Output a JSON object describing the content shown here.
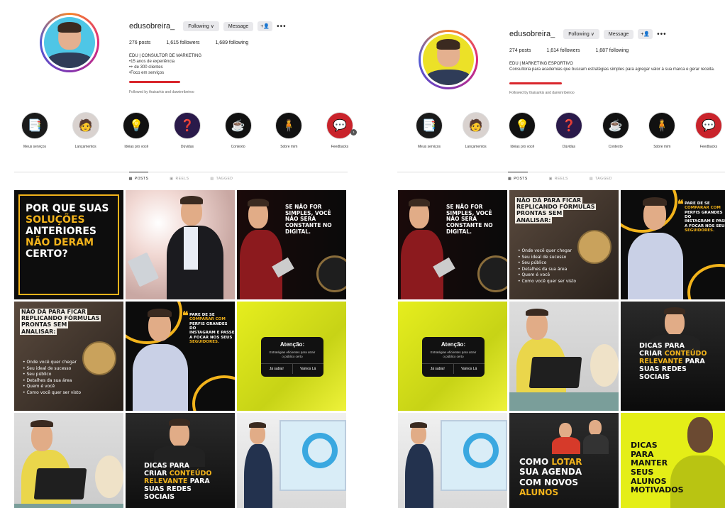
{
  "left": {
    "username": "edusobreira_",
    "following_btn": "Following ∨",
    "message_btn": "Message",
    "add_user_icon": "+👤",
    "more": "•••",
    "posts": "276 posts",
    "followers": "1,615 followers",
    "following": "1,689 following",
    "bio": [
      "EDU | CONSULTOR DE MARKETING",
      "•15 anos de experiência",
      "•+ de 300 clientes",
      "•Foco em serviços"
    ],
    "followed_by": "Followed by thaisarkis and darwinribeiroo",
    "highlights": [
      "Meus serviços",
      "Lançamentos",
      "Ideias pro você",
      "Dúvidas",
      "Contexto",
      "Sobre mim",
      "Feedbacks"
    ],
    "tabs": [
      "POSTS",
      "REELS",
      "TAGGED"
    ]
  },
  "right": {
    "username": "edusobreira_",
    "following_btn": "Following ∨",
    "message_btn": "Message",
    "add_user_icon": "+👤",
    "more": "•••",
    "posts": "274 posts",
    "followers": "1,614 followers",
    "following": "1,687 following",
    "bio": [
      "EDU | MARKETING ESPORTIVO",
      "Consultoria para academias que buscam estratégias simples para agregar valor à sua marca e gerar receita."
    ],
    "followed_by": "Followed by thaisarkis and darwinribeiroo",
    "highlights": [
      "Meus serviços",
      "Lançamentos",
      "Ideias pro você",
      "Dúvidas",
      "Contexto",
      "Sobre mim",
      "Feedbacks"
    ],
    "tabs": [
      "POSTS",
      "REELS",
      "TAGGED"
    ]
  },
  "posts": {
    "por_que": [
      "POR QUE SUAS",
      "SOLUÇÕES",
      "ANTERIORES",
      "NÃO DERAM",
      "CERTO?"
    ],
    "se_nao": [
      "SE NÃO FOR",
      "SIMPLES, VOCÊ",
      "NÃO SERÁ",
      "CONSTANTE NO",
      "DIGITAL."
    ],
    "nao_da": [
      "NÃO DÁ PARA FICAR",
      "REPLICANDO FÓRMULAS",
      "PRONTAS SEM",
      "ANALISAR:"
    ],
    "nao_da_items": [
      "• Onde você quer chegar",
      "• Seu ideal de sucesso",
      "• Seu público",
      "• Detalhes da sua área",
      "• Quem é você",
      "• Como você quer ser visto"
    ],
    "pare": [
      "PARE DE SE",
      "COMPARAR COM",
      "PERFIS GRANDES DO",
      "INSTAGRAM E PASSE",
      "A FOCAR NOS SEUS",
      "SEGUIDORES."
    ],
    "atencao_title": "Atenção:",
    "atencao_sub": "Estratégias eficientes para atrair o público certo",
    "atencao_b1": "Já sabia!",
    "atencao_b2": "Vamos Lá",
    "dicas": [
      "DICAS PARA",
      "CRIAR CONTEÚDO",
      "RELEVANTE PARA",
      "SUAS REDES",
      "SOCIAIS"
    ],
    "como_lotar": [
      "COMO LOTAR",
      "SUA AGENDA",
      "COM NOVOS",
      "ALUNOS"
    ],
    "dicas_manter": [
      "DICAS",
      "PARA",
      "MANTER",
      "SEUS",
      "ALUNOS",
      "MOTIVADOS"
    ]
  },
  "colors": {
    "gold": "#f2b31b",
    "yellow": "#e6ee1e",
    "red": "#d9262c"
  }
}
